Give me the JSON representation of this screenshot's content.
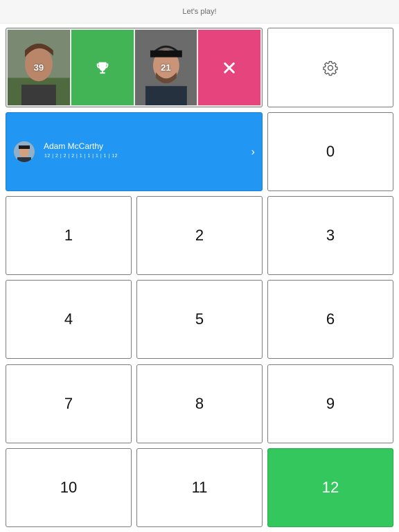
{
  "app": {
    "title": "Let's play!"
  },
  "players": [
    {
      "type": "photo",
      "score": "39",
      "active": false
    },
    {
      "type": "win"
    },
    {
      "type": "photo",
      "score": "21",
      "active": true
    },
    {
      "type": "lose"
    }
  ],
  "icons": {
    "settings": "gear-icon",
    "trophy": "trophy-icon",
    "close": "close-icon",
    "chevron": "chevron-right-icon"
  },
  "current_player": {
    "name": "Adam McCarthy",
    "scores": "12 | 2 | 2 | 2 | 1 | 1 | 1 | 1 | 12",
    "chevron": "›"
  },
  "keypad": {
    "k0": "0",
    "k1": "1",
    "k2": "2",
    "k3": "3",
    "k4": "4",
    "k5": "5",
    "k6": "6",
    "k7": "7",
    "k8": "8",
    "k9": "9",
    "k10": "10",
    "k11": "11",
    "k12": "12",
    "selected": "12"
  },
  "colors": {
    "accent_blue": "#2196f3",
    "win_green": "#43b456",
    "lose_pink": "#e5447c",
    "selected_green": "#34c75d"
  }
}
